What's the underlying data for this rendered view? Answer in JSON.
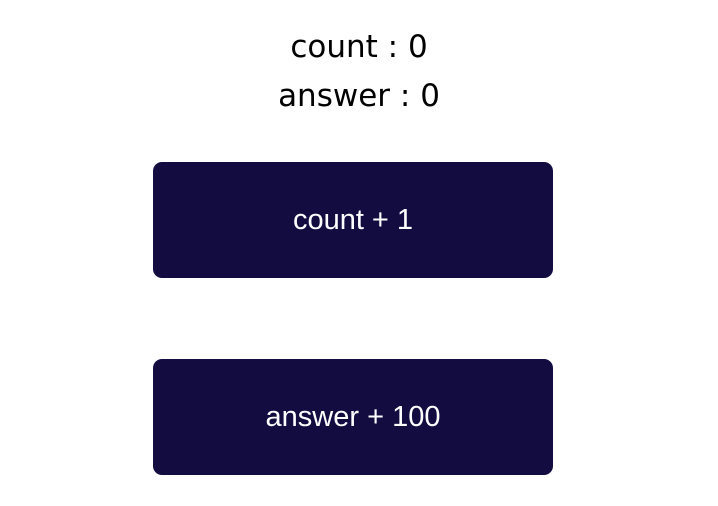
{
  "colors": {
    "button_background": "#120c41",
    "button_text": "#ffffff",
    "page_background": "#ffffff",
    "text": "#000000"
  },
  "display": {
    "count_label": "count",
    "count_separator": " : ",
    "count_value": "0",
    "answer_label": "answer",
    "answer_separator": " : ",
    "answer_value": "0"
  },
  "buttons": {
    "increment_count_label": "count + 1",
    "increment_answer_label": "answer + 100"
  }
}
